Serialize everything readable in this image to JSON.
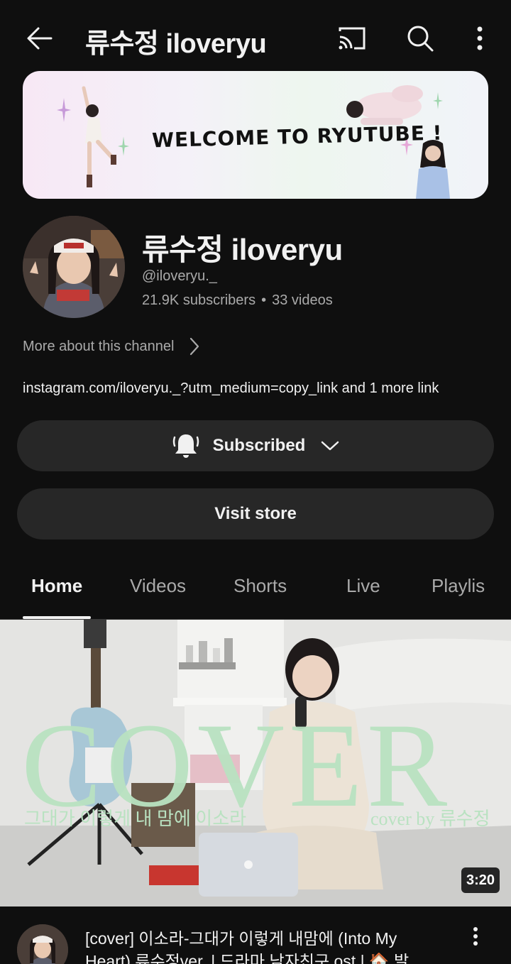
{
  "topbar": {
    "title": "류수정 iloveryu",
    "back_icon": "arrow-left-icon",
    "cast_icon": "cast-icon",
    "search_icon": "search-icon",
    "more_icon": "more-vert-icon"
  },
  "banner": {
    "text": "WELCOME TO RYUTUBE !"
  },
  "channel": {
    "name": "류수정 iloveryu",
    "handle": "@iloveryu._",
    "subscribers": "21.9K subscribers",
    "separator": "•",
    "videos": "33 videos",
    "more_about": "More about this channel",
    "links": "instagram.com/iloveryu._?utm_medium=copy_link and 1 more link"
  },
  "buttons": {
    "subscribed": "Subscribed",
    "visit_store": "Visit store"
  },
  "tabs": [
    {
      "label": "Home",
      "active": true
    },
    {
      "label": "Videos",
      "active": false
    },
    {
      "label": "Shorts",
      "active": false
    },
    {
      "label": "Live",
      "active": false
    },
    {
      "label": "Playlis",
      "active": false
    }
  ],
  "video": {
    "overlay_big": "COVER",
    "overlay_left": "그대가 이렇게 내 맘에 이소라",
    "overlay_right": "cover by 류수정",
    "duration": "3:20",
    "title": "[cover] 이소라-그대가 이렇게 내맘에 (Into My Heart) 류수정ver. | 드라마 남자친구 ost | 🏠 발"
  },
  "colors": {
    "background": "#0f0f0f",
    "button_bg": "#272727",
    "secondary_text": "#aaaaaa",
    "primary_text": "#f1f1f1",
    "cover_green": "#b9e2c1"
  }
}
